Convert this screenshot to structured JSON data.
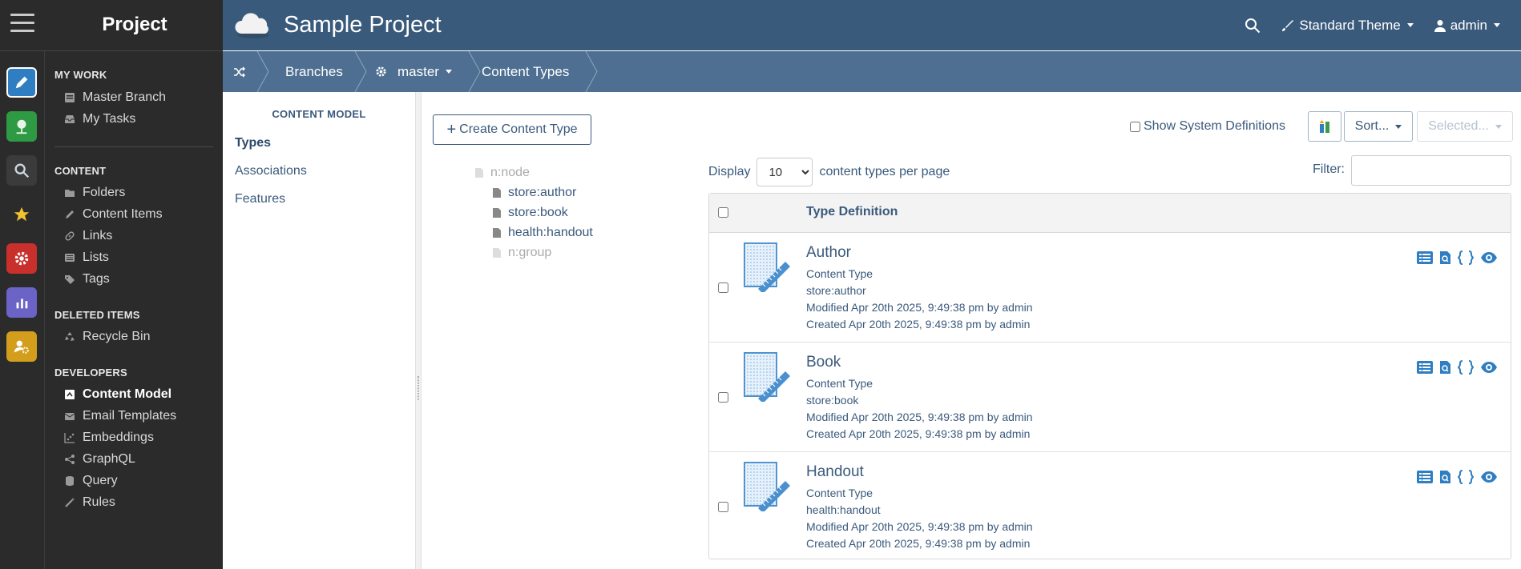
{
  "sidebar": {
    "title": "Project",
    "sections": [
      {
        "heading": "MY WORK",
        "items": [
          {
            "label": "Master Branch",
            "icon": "branch-icon"
          },
          {
            "label": "My Tasks",
            "icon": "inbox-icon"
          }
        ]
      },
      {
        "heading": "CONTENT",
        "items": [
          {
            "label": "Folders",
            "icon": "folder-icon"
          },
          {
            "label": "Content Items",
            "icon": "pencil-icon"
          },
          {
            "label": "Links",
            "icon": "link-icon"
          },
          {
            "label": "Lists",
            "icon": "list-icon"
          },
          {
            "label": "Tags",
            "icon": "tags-icon"
          }
        ]
      },
      {
        "heading": "DELETED ITEMS",
        "items": [
          {
            "label": "Recycle Bin",
            "icon": "recycle-icon"
          }
        ]
      },
      {
        "heading": "DEVELOPERS",
        "items": [
          {
            "label": "Content Model",
            "icon": "content-model-icon",
            "active": true
          },
          {
            "label": "Email Templates",
            "icon": "envelope-icon"
          },
          {
            "label": "Embeddings",
            "icon": "scatter-icon"
          },
          {
            "label": "GraphQL",
            "icon": "graphql-icon"
          },
          {
            "label": "Query",
            "icon": "database-icon"
          },
          {
            "label": "Rules",
            "icon": "wand-icon"
          }
        ]
      }
    ],
    "app_icons": [
      {
        "name": "edit-app-icon",
        "color": "#2f7ec1"
      },
      {
        "name": "tree-app-icon",
        "color": "#2e9a43"
      },
      {
        "name": "search-app-icon",
        "color": "#3b3b3b"
      },
      {
        "name": "star-app-icon",
        "color": "#2b2b2b"
      },
      {
        "name": "settings-app-icon",
        "color": "#c9302c"
      },
      {
        "name": "analytics-app-icon",
        "color": "#6c63c7"
      },
      {
        "name": "admin-app-icon",
        "color": "#d39e1c"
      }
    ]
  },
  "header": {
    "title": "Sample Project",
    "theme_label": "Standard Theme",
    "user_label": "admin",
    "bg": "#3a5a7c"
  },
  "breadcrumb": {
    "branches": "Branches",
    "branch": "master",
    "current": "Content Types"
  },
  "subnav": {
    "title": "CONTENT MODEL",
    "items": [
      "Types",
      "Associations",
      "Features"
    ]
  },
  "toolbar": {
    "create_label": "Create Content Type",
    "show_system_label": "Show System Definitions",
    "sort_label": "Sort...",
    "selected_label": "Selected..."
  },
  "paging": {
    "display_label": "Display",
    "page_size": "10",
    "suffix": "content types per page",
    "filter_label": "Filter:"
  },
  "tree": [
    {
      "label": "n:node",
      "dim": true
    },
    {
      "label": "store:author",
      "dim": false
    },
    {
      "label": "store:book",
      "dim": false
    },
    {
      "label": "health:handout",
      "dim": false
    },
    {
      "label": "n:group",
      "dim": true
    }
  ],
  "table": {
    "header": "Type Definition",
    "rows": [
      {
        "name": "Author",
        "kind": "Content Type",
        "qname": "store:author",
        "modified": "Modified Apr 20th 2025, 9:49:38 pm by admin",
        "created": "Created Apr 20th 2025, 9:49:38 pm by admin"
      },
      {
        "name": "Book",
        "kind": "Content Type",
        "qname": "store:book",
        "modified": "Modified Apr 20th 2025, 9:49:38 pm by admin",
        "created": "Created Apr 20th 2025, 9:49:38 pm by admin"
      },
      {
        "name": "Handout",
        "kind": "Content Type",
        "qname": "health:handout",
        "modified": "Modified Apr 20th 2025, 9:49:38 pm by admin",
        "created": "Created Apr 20th 2025, 9:49:38 pm by admin"
      }
    ]
  }
}
